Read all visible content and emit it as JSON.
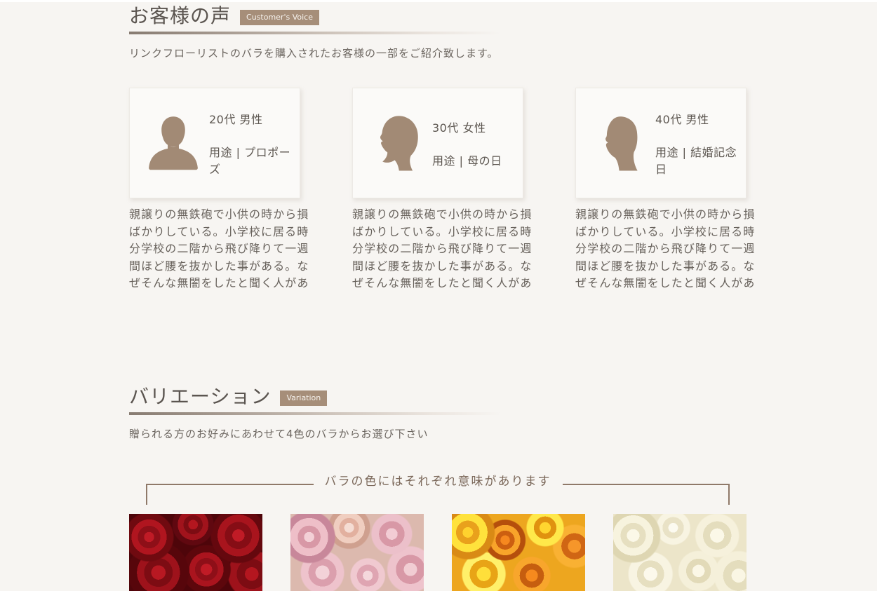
{
  "colors": {
    "page_bg": "#f7f5f2",
    "accent_brown": "#a68e79",
    "bracket_brown": "#8f7969",
    "heading_text": "#5b5550",
    "body_text": "#67615b",
    "card_bg": "#fbfaf8"
  },
  "voice": {
    "title": "お客様の声",
    "badge": "Customer's Voice",
    "description": "リンクフローリストのバラを購入されたお客様の一部をご紹介致します。",
    "cards": [
      {
        "icon": "male-front-silhouette",
        "profile": "20代 男性",
        "purpose": "用途 | プロポーズ",
        "testimonial": "親譲りの無鉄砲で小供の時から損ばかりしている。小学校に居る時分学校の二階から飛び降りて一週間ほど腰を抜かした事がある。なぜそんな無闇をしたと聞く人があ"
      },
      {
        "icon": "female-profile-silhouette",
        "profile": "30代 女性",
        "purpose": "用途 | 母の日",
        "testimonial": "親譲りの無鉄砲で小供の時から損ばかりしている。小学校に居る時分学校の二階から飛び降りて一週間ほど腰を抜かした事がある。なぜそんな無闇をしたと聞く人があ"
      },
      {
        "icon": "male-profile-silhouette",
        "profile": "40代 男性",
        "purpose": "用途 | 結婚記念日",
        "testimonial": "親譲りの無鉄砲で小供の時から損ばかりしている。小学校に居る時分学校の二階から飛び降りて一週間ほど腰を抜かした事がある。なぜそんな無闇をしたと聞く人があ"
      }
    ]
  },
  "variation": {
    "title": "バリエーション",
    "badge": "Variation",
    "description": "贈られる方のお好みにあわせて4色のバラからお選び下さい",
    "bracket_label": "バラの色にはそれぞれ意味があります",
    "rose_photos": [
      {
        "name": "red-roses-photo"
      },
      {
        "name": "pink-roses-photo"
      },
      {
        "name": "orange-yellow-roses-photo"
      },
      {
        "name": "white-roses-photo"
      }
    ]
  }
}
